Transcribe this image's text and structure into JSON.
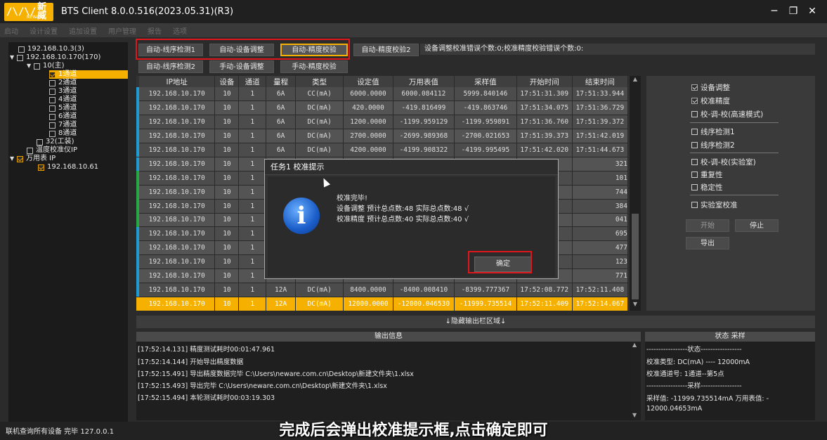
{
  "app": {
    "logo_cn": "新威",
    "logo_en": "NEWARE",
    "title": "BTS Client 8.0.0.516(2023.05.31)(R3)"
  },
  "toolbar": [
    "启动",
    "设计设置",
    "追加设置",
    "用户管理",
    "报告",
    "选项"
  ],
  "tree": {
    "nodes": [
      {
        "label": "192.168.10.3(3)",
        "checked": false
      },
      {
        "label": "192.168.10.170(170)",
        "checked": false
      },
      {
        "label": "10(主)",
        "checked": false
      },
      {
        "label": "1通道",
        "checked": true
      },
      {
        "label": "2通道",
        "checked": false
      },
      {
        "label": "3通道",
        "checked": false
      },
      {
        "label": "4通道",
        "checked": false
      },
      {
        "label": "5通道",
        "checked": false
      },
      {
        "label": "6通道",
        "checked": false
      },
      {
        "label": "7通道",
        "checked": false
      },
      {
        "label": "8通道",
        "checked": false
      },
      {
        "label": "32(工装)",
        "checked": false
      },
      {
        "label": "温度校准仪IP",
        "checked": false
      },
      {
        "label": "万用表 IP",
        "checked": true
      },
      {
        "label": "192.168.10.61",
        "checked": true
      }
    ]
  },
  "buttons": {
    "auto_seq1": "自动-线序检测1",
    "auto_adjust": "自动-设备调整",
    "auto_precision": "自动-精度校验",
    "auto_precision2": "自动-精度校验2",
    "auto_seq2": "自动-线序检测2",
    "manual_adjust": "手动-设备调整",
    "manual_precision": "手动-精度校验"
  },
  "error_info": "设备调整校准错误个数:0;校准精度校验错误个数:0:",
  "table": {
    "headers": [
      "IP地址",
      "设备",
      "通道",
      "量程",
      "类型",
      "设定值",
      "万用表值",
      "采样值",
      "开始时间",
      "结束时间"
    ],
    "rows": [
      [
        "192.168.10.170",
        "10",
        "1",
        "6A",
        "CC(mA)",
        "6000.0000",
        "6000.084112",
        "5999.840146",
        "17:51:31.309",
        "17:51:33.944"
      ],
      [
        "192.168.10.170",
        "10",
        "1",
        "6A",
        "DC(mA)",
        "420.0000",
        "-419.816499",
        "-419.863746",
        "17:51:34.075",
        "17:51:36.729"
      ],
      [
        "192.168.10.170",
        "10",
        "1",
        "6A",
        "DC(mA)",
        "1200.0000",
        "-1199.959129",
        "-1199.959891",
        "17:51:36.760",
        "17:51:39.372"
      ],
      [
        "192.168.10.170",
        "10",
        "1",
        "6A",
        "DC(mA)",
        "2700.0000",
        "-2699.989368",
        "-2700.021653",
        "17:51:39.373",
        "17:51:42.019"
      ],
      [
        "192.168.10.170",
        "10",
        "1",
        "6A",
        "DC(mA)",
        "4200.0000",
        "-4199.908322",
        "-4199.995495",
        "17:51:42.020",
        "17:51:44.673"
      ],
      [
        "192.168.10.170",
        "10",
        "1",
        "",
        "",
        "",
        "",
        "",
        "",
        "321"
      ],
      [
        "192.168.10.170",
        "10",
        "1",
        "",
        "",
        "",
        "",
        "",
        "",
        "101"
      ],
      [
        "192.168.10.170",
        "10",
        "1",
        "",
        "",
        "",
        "",
        "",
        "",
        "744"
      ],
      [
        "192.168.10.170",
        "10",
        "1",
        "",
        "",
        "",
        "",
        "",
        "",
        "384"
      ],
      [
        "192.168.10.170",
        "10",
        "1",
        "",
        "",
        "",
        "",
        "",
        "",
        "041"
      ],
      [
        "192.168.10.170",
        "10",
        "1",
        "",
        "",
        "",
        "",
        "",
        "",
        "695"
      ],
      [
        "192.168.10.170",
        "10",
        "1",
        "",
        "",
        "",
        "",
        "",
        "",
        "477"
      ],
      [
        "192.168.10.170",
        "10",
        "1",
        "",
        "",
        "",
        "",
        "",
        "",
        "123"
      ],
      [
        "192.168.10.170",
        "10",
        "1",
        "",
        "",
        "",
        "",
        "",
        "",
        "771"
      ],
      [
        "192.168.10.170",
        "10",
        "1",
        "12A",
        "DC(mA)",
        "8400.0000",
        "-8400.008410",
        "-8399.777367",
        "17:52:08.772",
        "17:52:11.408"
      ],
      [
        "192.168.10.170",
        "10",
        "1",
        "12A",
        "DC(mA)",
        "12000.0000",
        "-12000.046530",
        "-11999.735514",
        "17:52:11.409",
        "17:52:14.067"
      ]
    ]
  },
  "options": {
    "items": [
      {
        "label": "设备调整",
        "checked": true
      },
      {
        "label": "校准精度",
        "checked": true
      },
      {
        "label": "校-调-校(高速模式)",
        "checked": false
      },
      {
        "label": "线序检测1",
        "checked": false
      },
      {
        "label": "线序检测2",
        "checked": false
      },
      {
        "label": "校-调-校(实验室)",
        "checked": false
      },
      {
        "label": "重复性",
        "checked": false
      },
      {
        "label": "稳定性",
        "checked": false
      },
      {
        "label": "实验室校准",
        "checked": false
      }
    ],
    "start": "开始",
    "stop": "停止",
    "export": "导出"
  },
  "hide_output": "↓隐藏输出栏区域↓",
  "output": {
    "header": "输出信息",
    "lines": [
      "[17:52:14.131] 精度测试耗时00:01:47.961",
      "[17:52:14.144] 开始导出精度数据",
      "[17:52:15.491] 导出精度数据完毕 C:\\Users\\neware.com.cn\\Desktop\\新建文件夹\\1.xlsx",
      "[17:52:15.493] 导出完毕 C:\\Users\\neware.com.cn\\Desktop\\新建文件夹\\1.xlsx",
      "[17:52:15.494] 本轮测试耗时00:03:19.303"
    ]
  },
  "status": {
    "header": "状态 采样",
    "lines": [
      "-----------------状态-----------------",
      "校准类型:  DC(mA) ---- 12000mA",
      "校准通道号: 1通道--第5点",
      "-----------------采样-----------------",
      "采样值: -11999.735514mA 万用表值: -",
      "12000.04653mA"
    ]
  },
  "statusbar": "联机查询所有设备 完毕 127.0.0.1",
  "subtitle": "完成后会弹出校准提示框,点击确定即可",
  "dialog": {
    "title": "任务1 校准提示",
    "lines": [
      "校准完毕!",
      "设备调整 预计总点数:48 实际总点数:48 √",
      "校准精度 预计总点数:40 实际总点数:40 √"
    ],
    "ok": "确定"
  },
  "colors": {
    "accent": "#f5b000",
    "highlight_red": "#e0161a",
    "row_strip_blue": "#1e9bd0",
    "row_strip_green": "#27a844"
  }
}
